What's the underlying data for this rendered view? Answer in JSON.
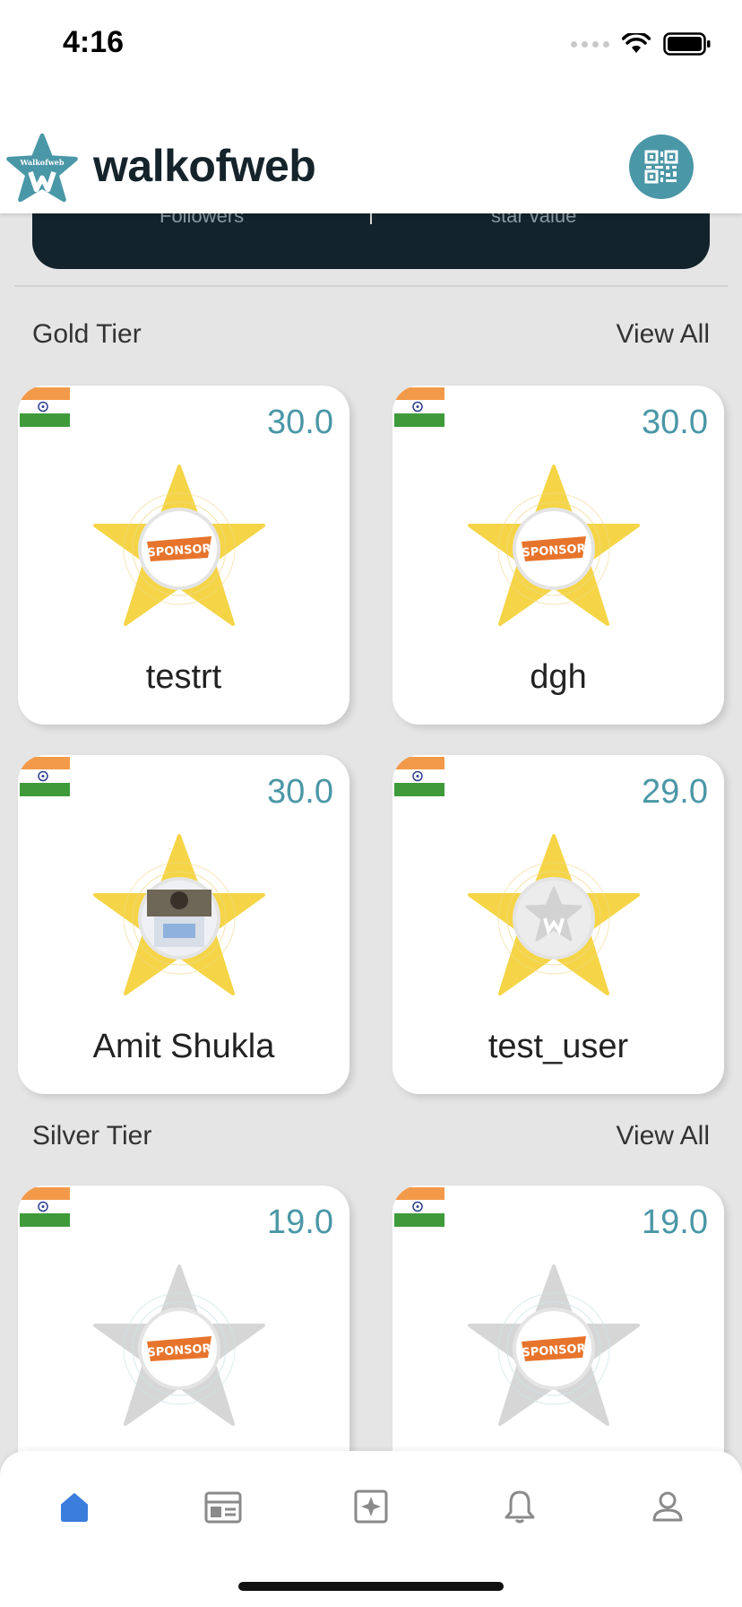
{
  "status_bar": {
    "time": "4:16"
  },
  "header": {
    "app_name": "walkofweb",
    "logo_text": "Walkofweb"
  },
  "stats": {
    "followers_label": "Followers",
    "star_value_label": "star value"
  },
  "gold_tier": {
    "title": "Gold Tier",
    "view_all": "View All",
    "cards": [
      {
        "name": "testrt",
        "score": "30.0",
        "badge": "SPONSOR"
      },
      {
        "name": "dgh",
        "score": "30.0",
        "badge": "SPONSOR"
      },
      {
        "name": "Amit Shukla",
        "score": "30.0",
        "badge": ""
      },
      {
        "name": "test_user",
        "score": "29.0",
        "badge": ""
      }
    ]
  },
  "silver_tier": {
    "title": "Silver Tier",
    "view_all": "View All",
    "cards": [
      {
        "score": "19.0",
        "badge": "SPONSOR"
      },
      {
        "score": "19.0",
        "badge": "SPONSOR"
      }
    ]
  },
  "nav": {
    "items": [
      {
        "icon": "home-icon",
        "active": true
      },
      {
        "icon": "feed-icon",
        "active": false
      },
      {
        "icon": "sparkle-icon",
        "active": false
      },
      {
        "icon": "bell-icon",
        "active": false
      },
      {
        "icon": "profile-icon",
        "active": false
      }
    ]
  },
  "colors": {
    "accent": "#4a97a7",
    "gold_star": "#f5d547",
    "silver_star": "#d6d6d6",
    "dark_card": "#13232b",
    "nav_active": "#3b7ddd",
    "nav_inactive": "#8a8a8a"
  }
}
